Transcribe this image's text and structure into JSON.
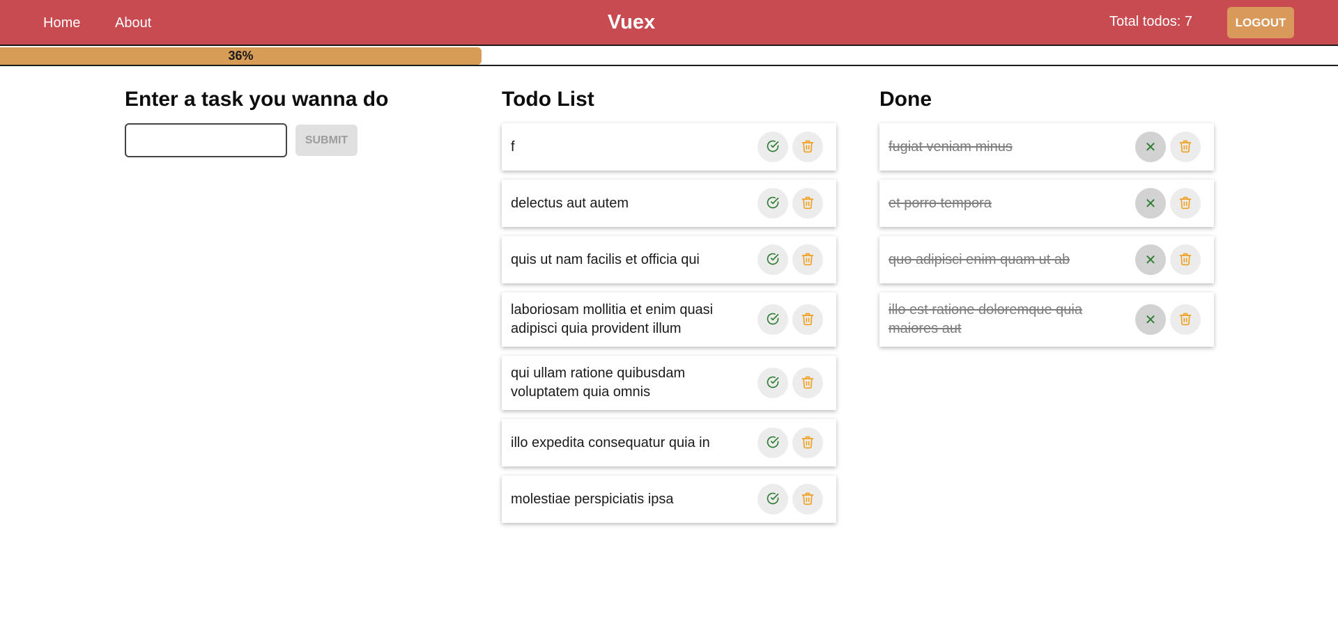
{
  "navbar": {
    "home_label": "Home",
    "about_label": "About",
    "brand": "Vuex",
    "total_label": "Total todos: 7",
    "logout_label": "LOGOUT"
  },
  "progress": {
    "value": 0.36,
    "label": "36%"
  },
  "entry": {
    "title": "Enter a task you wanna do",
    "input_value": "",
    "input_placeholder": "",
    "submit_label": "SUBMIT"
  },
  "todo": {
    "title": "Todo List",
    "items": [
      {
        "text": "f"
      },
      {
        "text": "delectus aut autem"
      },
      {
        "text": "quis ut nam facilis et officia qui"
      },
      {
        "text": "laboriosam mollitia et enim quasi adipisci quia provident illum"
      },
      {
        "text": "qui ullam ratione quibusdam voluptatem quia omnis"
      },
      {
        "text": "illo expedita consequatur quia in"
      },
      {
        "text": "molestiae perspiciatis ipsa"
      }
    ]
  },
  "done": {
    "title": "Done",
    "items": [
      {
        "text": "fugiat veniam minus"
      },
      {
        "text": "et porro tempora"
      },
      {
        "text": "quo adipisci enim quam ut ab"
      },
      {
        "text": "illo est ratione doloremque quia maiores aut"
      }
    ]
  },
  "icons": {
    "complete": "check-circle-icon",
    "undo": "close-icon",
    "delete": "trash-icon"
  },
  "colors": {
    "navbar": "#c94b52",
    "accent": "#d9995a",
    "progress": "#d79d57",
    "check": "#2e7d32",
    "trash": "#f0a020"
  }
}
